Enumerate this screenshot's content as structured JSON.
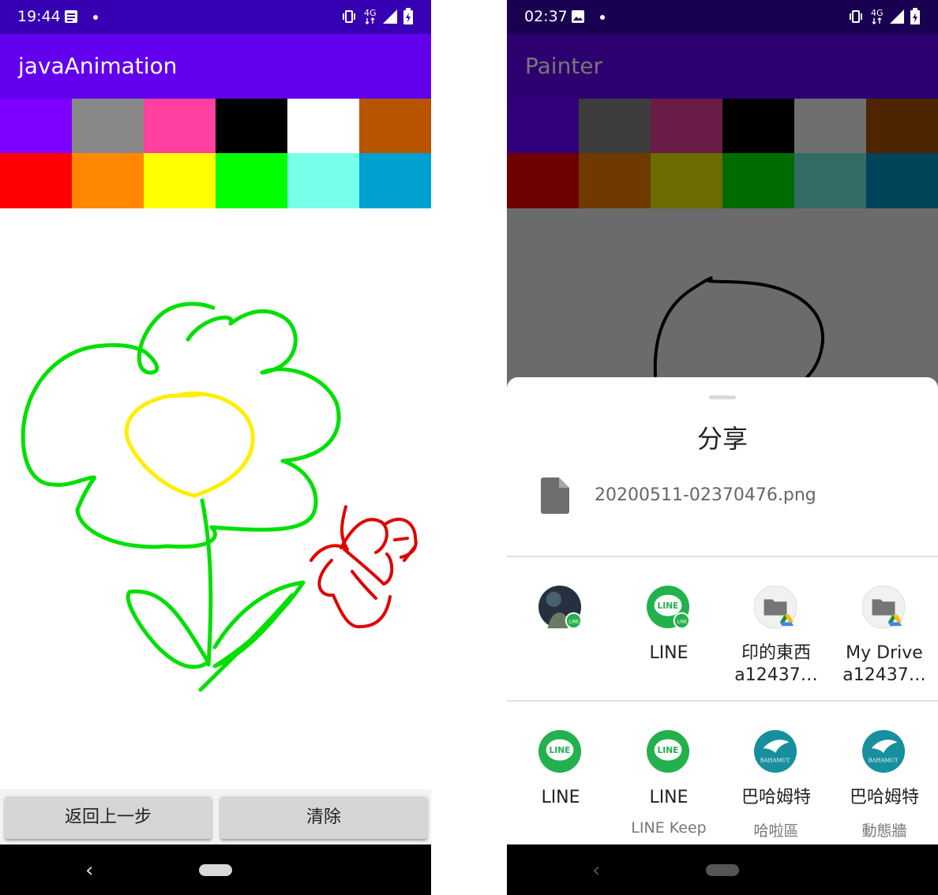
{
  "left_screen": {
    "status_bar": {
      "time": "19:44",
      "icons": [
        "notes-icon",
        "dot-icon",
        "vibrate-icon",
        "4g-icon",
        "signal-icon",
        "battery-icon"
      ],
      "color": "#3700b3"
    },
    "app_bar": {
      "title": "javaAnimation",
      "color": "#6200ee"
    },
    "palette": {
      "row1": [
        "#7f00ff",
        "#888888",
        "#ff40a0",
        "#000000",
        "#ffffff",
        "#b85400"
      ],
      "row2": [
        "#ff0000",
        "#ff8800",
        "#ffff00",
        "#00ff00",
        "#77ffea",
        "#00a0d0"
      ]
    },
    "canvas": {
      "background": "#ffffff",
      "stroke_colors": [
        "#00e000",
        "#ffee00",
        "#e00000"
      ]
    },
    "buttons": {
      "undo_label": "返回上一步",
      "clear_label": "清除"
    }
  },
  "right_screen": {
    "status_bar": {
      "time": "02:37",
      "icons": [
        "image-icon",
        "dot-icon",
        "vibrate-icon",
        "4g-icon",
        "signal-icon",
        "battery-icon"
      ]
    },
    "app_bar": {
      "title": "Painter"
    },
    "share_sheet": {
      "title": "分享",
      "file_name": "20200511-02370476.png",
      "direct_targets": [
        {
          "label": "",
          "sub": "",
          "icon": "contact-avatar-icon"
        },
        {
          "label": "LINE",
          "sub": "",
          "icon": "line-icon"
        },
        {
          "label": "印的東西",
          "sub2": "a12437…",
          "icon": "drive-folder-icon"
        },
        {
          "label": "My Drive",
          "sub2": "a12437…",
          "icon": "drive-folder-icon"
        }
      ],
      "app_targets": [
        {
          "label": "LINE",
          "sub": "",
          "icon": "line-icon"
        },
        {
          "label": "LINE",
          "sub": "LINE Keep",
          "icon": "line-icon"
        },
        {
          "label": "巴哈姆特",
          "sub": "哈啦區",
          "icon": "bahamut-icon",
          "badge": "BAHAMUT"
        },
        {
          "label": "巴哈姆特",
          "sub": "動態牆",
          "icon": "bahamut-icon",
          "badge": "BAHAMUT"
        }
      ]
    }
  }
}
